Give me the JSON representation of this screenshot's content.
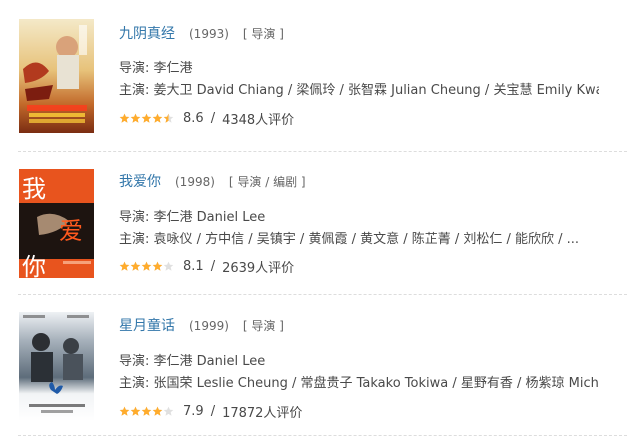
{
  "colors": {
    "link": "#3377aa",
    "star": "#ffac2d",
    "star_empty": "#e0e0e0"
  },
  "items": [
    {
      "title": "九阴真经",
      "year": "(1993)",
      "role": "[ 导演 ]",
      "director": "导演: 李仁港",
      "cast": "主演: 姜大卫 David Chiang / 梁佩玲 / 张智霖 Julian Cheung / 关宝慧 Emily Kwan ...",
      "rating": 4.5,
      "score": "8.6",
      "votes": "4348人评价",
      "poster_icon": "movie-poster-jiuyin"
    },
    {
      "title": "我爱你",
      "year": "(1998)",
      "role": "[ 导演 / 编剧 ]",
      "director": "导演: 李仁港 Daniel Lee",
      "cast": "主演: 袁咏仪 / 方中信 / 吴镇宇 / 黄佩霞 / 黄文意 / 陈芷菁 / 刘松仁 / 能欣欣 / ...",
      "rating": 4,
      "score": "8.1",
      "votes": "2639人评价",
      "poster_icon": "movie-poster-woaini",
      "poster_text": [
        "我",
        "爱",
        "你"
      ]
    },
    {
      "title": "星月童话",
      "year": "(1999)",
      "role": "[ 导演 ]",
      "director": "导演: 李仁港 Daniel Lee",
      "cast": "主演: 张国荣 Leslie Cheung / 常盘贵子 Takako Tokiwa / 星野有香 / 杨紫琼 Michel...",
      "rating": 4,
      "score": "7.9",
      "votes": "17872人评价",
      "poster_icon": "movie-poster-xingyue"
    }
  ],
  "separator": "/"
}
